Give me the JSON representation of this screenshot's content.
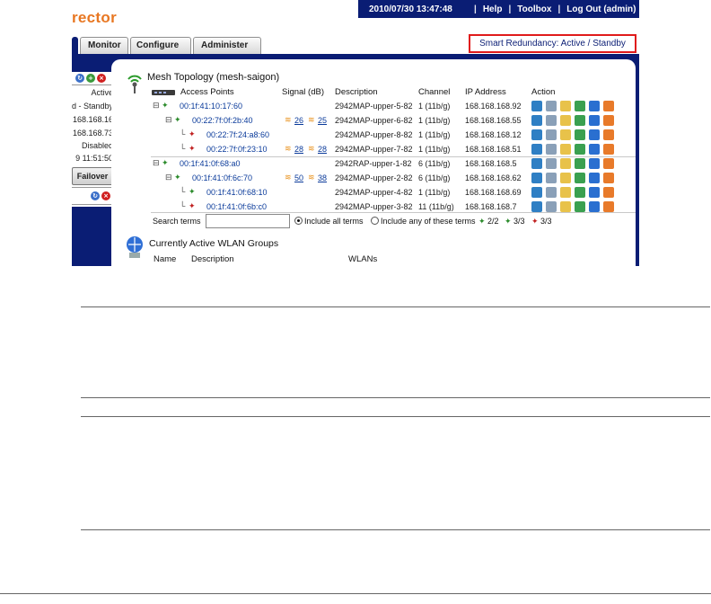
{
  "brand": "rector",
  "topbar": {
    "datetime": "2010/07/30  13:47:48",
    "help": "Help",
    "toolbox": "Toolbox",
    "logout": "Log Out (admin)"
  },
  "tabs": [
    "Monitor",
    "Configure",
    "Administer"
  ],
  "smart_redundancy": "Smart Redundancy: Active / Standby",
  "left_panel": {
    "rows": [
      "Active",
      "d - Standby",
      "168.168.16",
      "168.168.73",
      "Disabled",
      "9  11:51:50"
    ],
    "failover": "Failover"
  },
  "mesh": {
    "title": "Mesh Topology (mesh-saigon)",
    "headers": {
      "access_points": "Access Points",
      "signal": "Signal (dB)",
      "description": "Description",
      "channel": "Channel",
      "ip": "IP Address",
      "action": "Action"
    },
    "rows": [
      {
        "mac": "00:1f:41:10:17:60",
        "sig1": "",
        "sig2": "",
        "desc": "2942MAP-upper-5-82",
        "chan": "1 (11b/g)",
        "ip": "168.168.168.92"
      },
      {
        "mac": "00:22:7f:0f:2b:40",
        "sig1": "26",
        "sig2": "25",
        "desc": "2942MAP-upper-6-82",
        "chan": "1 (11b/g)",
        "ip": "168.168.168.55"
      },
      {
        "mac": "00:22:7f:24:a8:60",
        "sig1": "",
        "sig2": "",
        "desc": "2942MAP-upper-8-82",
        "chan": "1 (11b/g)",
        "ip": "168.168.168.12"
      },
      {
        "mac": "00:22:7f:0f:23:10",
        "sig1": "28",
        "sig2": "28",
        "desc": "2942MAP-upper-7-82",
        "chan": "1 (11b/g)",
        "ip": "168.168.168.51"
      },
      {
        "mac": "00:1f:41:0f:68:a0",
        "sig1": "",
        "sig2": "",
        "desc": "2942RAP-upper-1-82",
        "chan": "6 (11b/g)",
        "ip": "168.168.168.5"
      },
      {
        "mac": "00:1f:41:0f:6c:70",
        "sig1": "50",
        "sig2": "38",
        "desc": "2942MAP-upper-2-82",
        "chan": "6 (11b/g)",
        "ip": "168.168.168.62"
      },
      {
        "mac": "00:1f:41:0f:68:10",
        "sig1": "",
        "sig2": "",
        "desc": "2942MAP-upper-4-82",
        "chan": "1 (11b/g)",
        "ip": "168.168.168.69"
      },
      {
        "mac": "00:1f:41:0f:6b:c0",
        "sig1": "",
        "sig2": "",
        "desc": "2942MAP-upper-3-82",
        "chan": "11 (11b/g)",
        "ip": "168.168.168.7"
      }
    ],
    "search": {
      "label": "Search terms",
      "opt_all": "Include all terms",
      "opt_any": "Include any of these terms",
      "count1": "2/2",
      "count2": "3/3",
      "count3": "3/3"
    }
  },
  "wlan": {
    "title": "Currently Active WLAN Groups",
    "headers": {
      "name": "Name",
      "description": "Description",
      "wlans": "WLANs"
    }
  }
}
